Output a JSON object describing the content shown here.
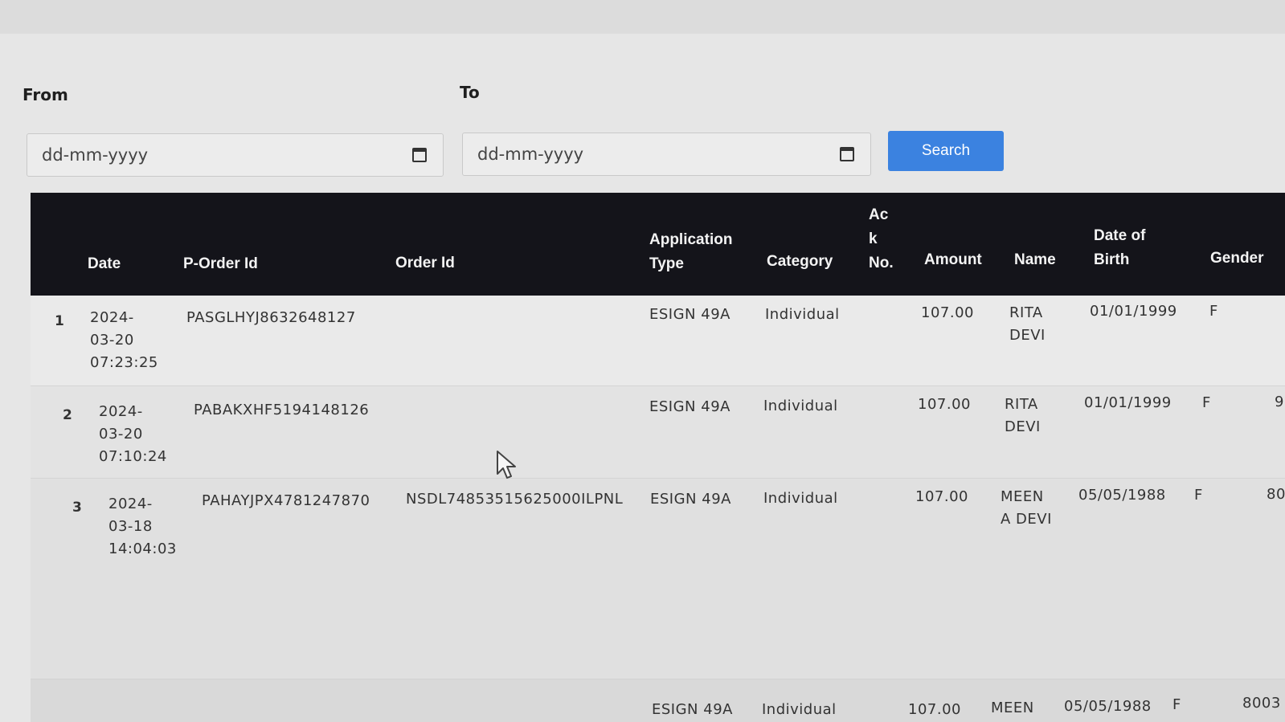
{
  "filters": {
    "from_label": "From",
    "to_label": "To",
    "from_placeholder": "dd-mm-yyyy",
    "to_placeholder": "dd-mm-yyyy",
    "calendar_icon": "calendar-icon",
    "search_label": "Search"
  },
  "colors": {
    "accent": "#3b82e0",
    "header_bg": "#14141a"
  },
  "table": {
    "headers": {
      "date": "Date",
      "p_order_id": "P-Order Id",
      "order_id": "Order Id",
      "application_type": "Application\nType",
      "category": "Category",
      "ack_no": "Ac\nk\nNo.",
      "amount": "Amount",
      "name": "Name",
      "dob": "Date of\nBirth",
      "gender": "Gender"
    },
    "rows": [
      {
        "num": "1",
        "date": "2024-\n03-20\n07:23:25",
        "p_order_id": "PASGLHYJ8632648127",
        "order_id": "",
        "application_type": "ESIGN 49A",
        "category": "Individual",
        "ack_no": "",
        "amount": "107.00",
        "name": "RITA\nDEVI",
        "dob": "01/01/1999",
        "gender": "F",
        "extra": ""
      },
      {
        "num": "2",
        "date": "2024-\n03-20\n07:10:24",
        "p_order_id": "PABAKXHF5194148126",
        "order_id": "",
        "application_type": "ESIGN 49A",
        "category": "Individual",
        "ack_no": "",
        "amount": "107.00",
        "name": "RITA\nDEVI",
        "dob": "01/01/1999",
        "gender": "F",
        "extra": "9"
      },
      {
        "num": "3",
        "date": "2024-\n03-18\n14:04:03",
        "p_order_id": "PAHAYJPX4781247870",
        "order_id": "NSDL74853515625000ILPNL",
        "application_type": "ESIGN 49A",
        "category": "Individual",
        "ack_no": "",
        "amount": "107.00",
        "name": "MEEN\nA DEVI",
        "dob": "05/05/1988",
        "gender": "F",
        "extra": "80"
      },
      {
        "num": "",
        "date": "",
        "p_order_id": "",
        "order_id": "",
        "application_type": "ESIGN 49A",
        "category": "Individual",
        "ack_no": "",
        "amount": "107.00",
        "name": "MEEN",
        "dob": "05/05/1988",
        "gender": "F",
        "extra": "8003"
      }
    ]
  }
}
